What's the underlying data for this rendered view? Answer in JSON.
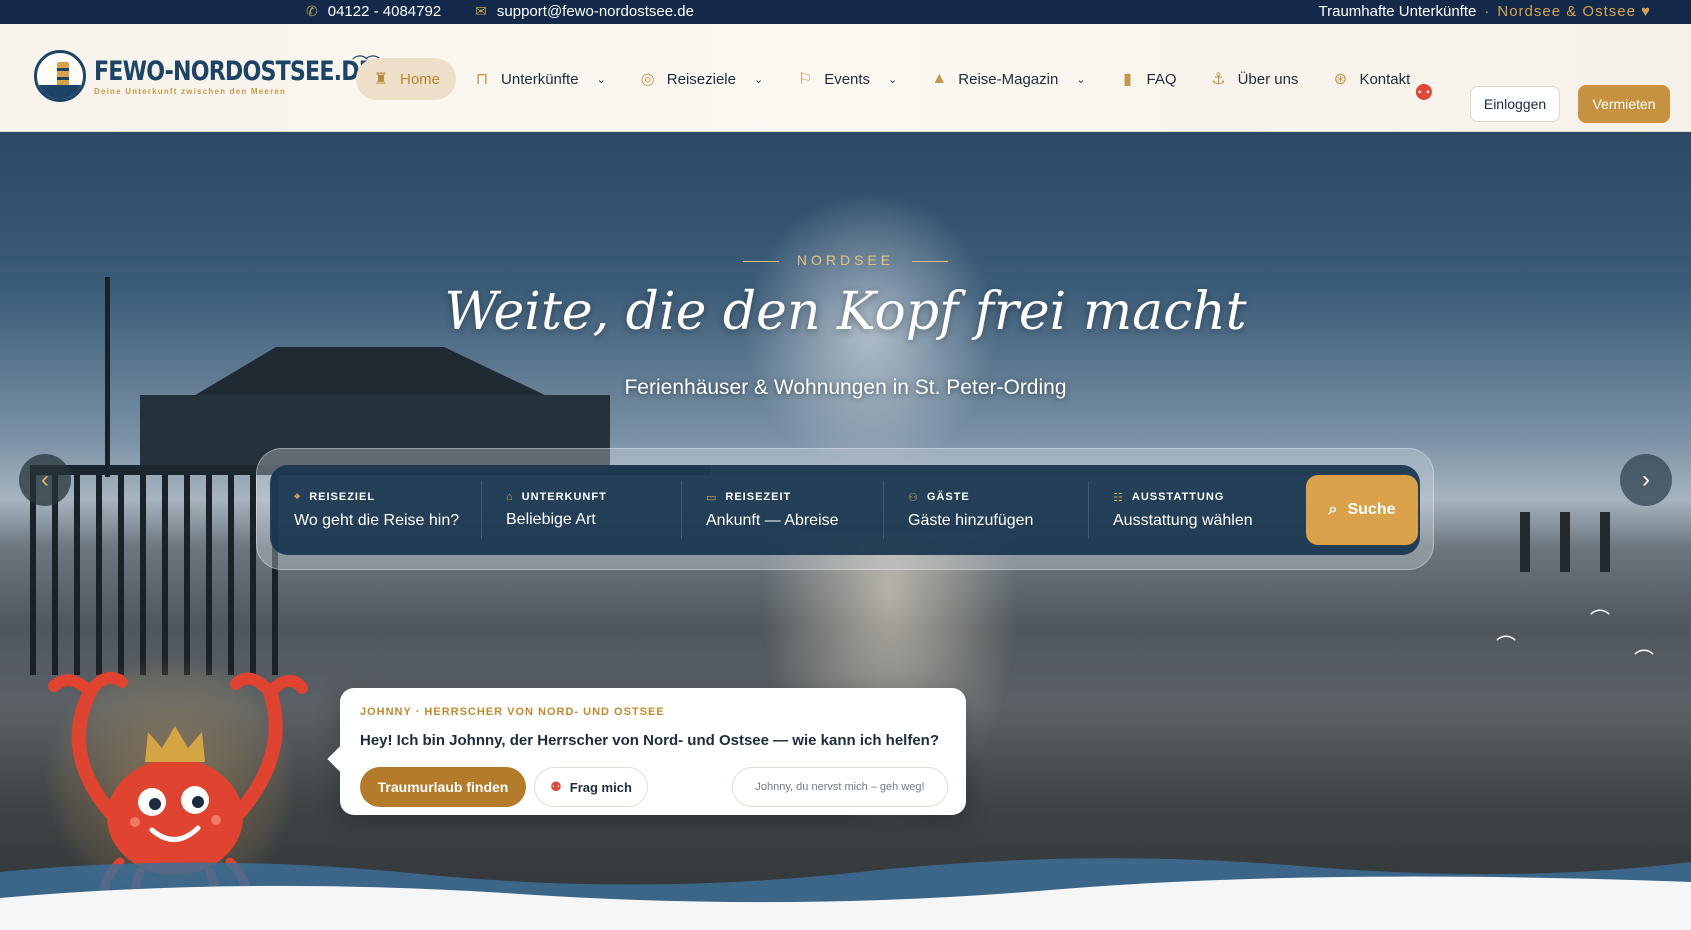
{
  "topbar": {
    "phone": "04122 - 4084792",
    "email": "support@fewo-nordostsee.de",
    "tagline": "Traumhafte Unterkünfte",
    "region": "Nordsee & Ostsee ♥"
  },
  "logo": {
    "name": "FEWO-NORDOSTSEE.DE",
    "tagline": "Deine Unterkunft zwischen den Meeren"
  },
  "nav": {
    "items": [
      {
        "label": "Home",
        "icon": "lighthouse-icon",
        "active": true
      },
      {
        "label": "Unterkünfte",
        "icon": "armchair-icon",
        "dropdown": true
      },
      {
        "label": "Reiseziele",
        "icon": "compass-icon",
        "dropdown": true
      },
      {
        "label": "Events",
        "icon": "flag-icon",
        "dropdown": true
      },
      {
        "label": "Reise-Magazin",
        "icon": "sailboat-icon",
        "dropdown": true
      },
      {
        "label": "FAQ",
        "icon": "buoy-icon"
      },
      {
        "label": "Über uns",
        "icon": "anchor-icon"
      },
      {
        "label": "Kontakt",
        "icon": "lifebuoy-icon"
      }
    ],
    "login_label": "Einloggen",
    "rent_label": "Vermieten"
  },
  "hero": {
    "eyebrow": "NORDSEE",
    "title": "Weite, die den Kopf frei macht",
    "subtitle": "Ferienhäuser & Wohnungen in St. Peter-Ording"
  },
  "search": {
    "fields": [
      {
        "label": "REISEZIEL",
        "value": "Wo geht die Reise hin?",
        "icon": "map-pin-icon"
      },
      {
        "label": "UNTERKUNFT",
        "value": "Beliebige Art",
        "icon": "house-icon"
      },
      {
        "label": "REISEZEIT",
        "value": "Ankunft — Abreise",
        "icon": "calendar-icon"
      },
      {
        "label": "GÄSTE",
        "value": "Gäste hinzufügen",
        "icon": "users-icon"
      },
      {
        "label": "AUSSTATTUNG",
        "value": "Ausstattung wählen",
        "icon": "list-icon"
      }
    ],
    "button_label": "Suche"
  },
  "chat": {
    "kicker": "JOHNNY · HERRSCHER VON NORD- UND OSTSEE",
    "message": "Hey! Ich bin Johnny, der Herrscher von Nord- und Ostsee — wie kann ich helfen?",
    "primary_label": "Traumurlaub finden",
    "ask_label": "Frag mich",
    "dismiss_label": "Johnny, du nervst mich – geh weg!"
  },
  "colors": {
    "navy": "#12294a",
    "gold": "#c79240",
    "crab_red": "#e2483a"
  }
}
